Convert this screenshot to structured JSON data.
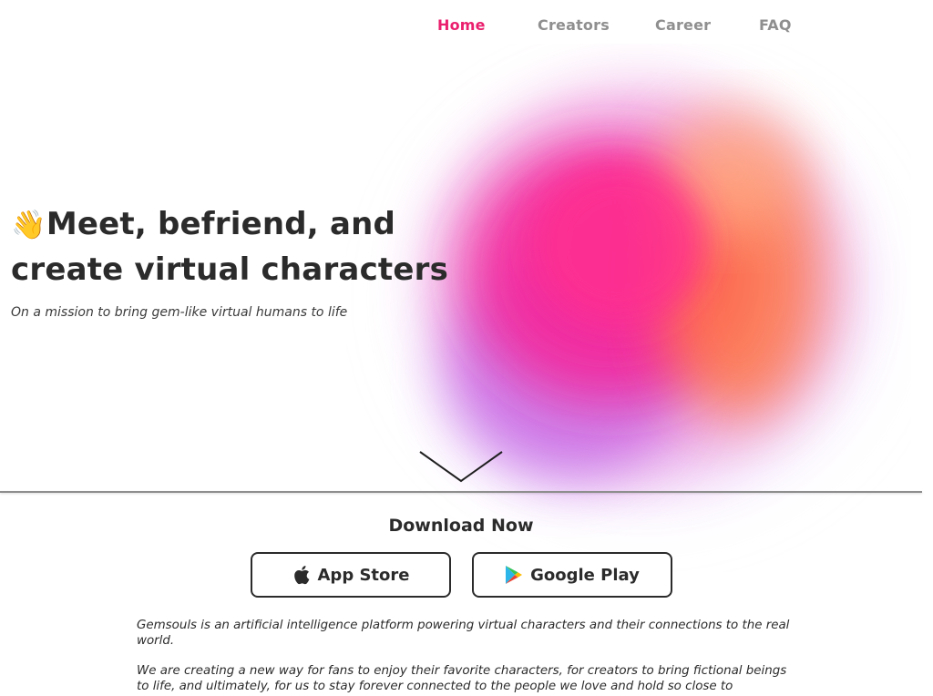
{
  "nav": {
    "items": [
      {
        "label": "Home",
        "active": true
      },
      {
        "label": "Creators",
        "active": false
      },
      {
        "label": "Career",
        "active": false
      },
      {
        "label": "FAQ",
        "active": false
      }
    ]
  },
  "hero": {
    "emoji": "👋",
    "title_line1": "Meet, befriend, and",
    "title_line2": "create virtual characters",
    "subtitle": "On a mission to bring gem-like virtual humans to life"
  },
  "download": {
    "title": "Download Now",
    "app_store_label": "App Store",
    "google_play_label": "Google Play"
  },
  "about": {
    "paragraph1": "Gemsouls is an artificial intelligence platform powering virtual characters and their connections to the real world.",
    "paragraph2": "We are creating a new way for fans to enjoy their favorite characters, for creators to bring fictional beings to life, and ultimately, for us to stay forever connected to the people we love and hold so close to"
  },
  "colors": {
    "accent": "#ea1f6d",
    "nav_inactive": "#8f8f8f",
    "text": "#2b2b2b"
  },
  "icons": {
    "app_store": "apple-icon",
    "google_play": "google-play-icon",
    "scroll": "chevron-down-icon",
    "hero": "waving-hand-icon"
  }
}
